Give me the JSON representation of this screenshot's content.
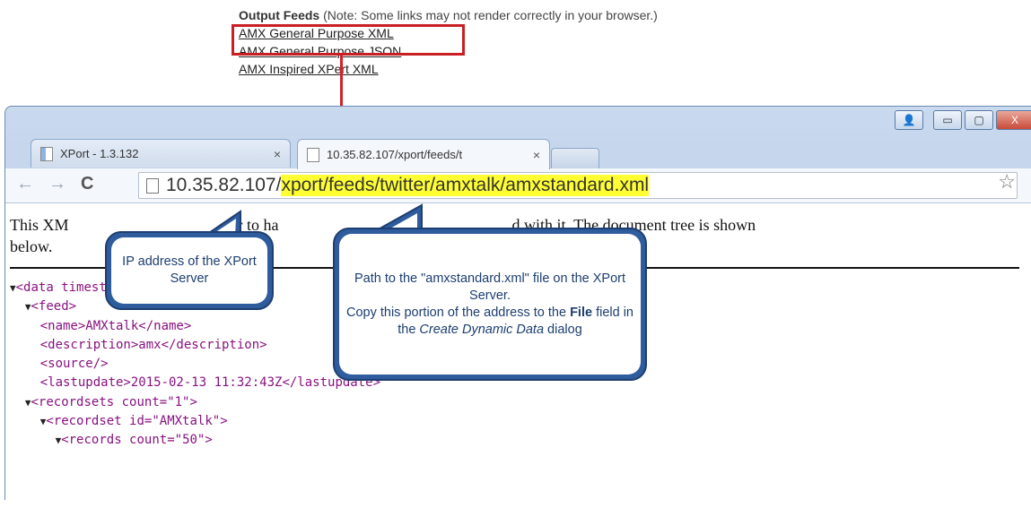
{
  "feeds": {
    "heading": "Output Feeds",
    "note": " (Note: Some links may not render correctly in your browser.)",
    "links": [
      "AMX General Purpose XML",
      "AMX General Purpose JSON",
      "AMX Inspired XPert XML"
    ]
  },
  "browser": {
    "tabs": [
      {
        "title": "XPort - 1.3.132",
        "close": "×"
      },
      {
        "title": "10.35.82.107/xport/feeds/t",
        "close": "×"
      }
    ],
    "nav": {
      "back": "←",
      "forward": "→",
      "reload": "C"
    },
    "url": {
      "host": "10.35.82.107/",
      "path": "xport/feeds/twitter/amxtalk/amxstandard.xml"
    },
    "star": "☆",
    "window_buttons": {
      "user": "👤",
      "minimize": "▭",
      "maximize": "▢",
      "close": "X"
    }
  },
  "content": {
    "message_start": "This XM",
    "message_mid": "ar to ha",
    "message_end": "d with it. The document tree is shown",
    "message_line2": "below.",
    "xml_lines": [
      {
        "indent": "",
        "arrow": "▼",
        "text": "<data timestamp=\"Fri, 13 Feb 2"
      },
      {
        "indent": "  ",
        "arrow": "▼",
        "text": "<feed>"
      },
      {
        "indent": "    ",
        "arrow": "",
        "text": "<name>AMXtalk</name>"
      },
      {
        "indent": "    ",
        "arrow": "",
        "text": "<description>amx</description>"
      },
      {
        "indent": "    ",
        "arrow": "",
        "text": "<source/>"
      },
      {
        "indent": "    ",
        "arrow": "",
        "text": "<lastupdate>2015-02-13 11:32:43Z</lastupdate>"
      },
      {
        "indent": "  ",
        "arrow": "▼",
        "text": "<recordsets count=\"1\">"
      },
      {
        "indent": "    ",
        "arrow": "▼",
        "text": "<recordset id=\"AMXtalk\">"
      },
      {
        "indent": "      ",
        "arrow": "▼",
        "text": "<records count=\"50\">"
      }
    ]
  },
  "callouts": {
    "ip": "IP address of the XPort Server",
    "path_line1": "Path to the \"amxstandard.xml\" file on the XPort Server.",
    "path_line2_pre": "Copy this portion of the address to the ",
    "path_bold": "File",
    "path_mid": " field in the ",
    "path_italic": "Create Dynamic Data",
    "path_post": " dialog"
  },
  "colors": {
    "highlight": "#ffff33",
    "callout_border": "#2f5c9d",
    "arrow": "#d2232a"
  }
}
